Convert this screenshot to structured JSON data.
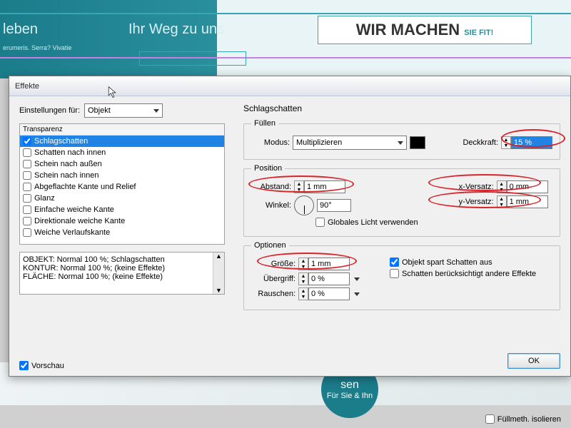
{
  "bg": {
    "nav1": "leben",
    "nav2": "Ihr Weg zu uns",
    "slogan1": "WIR MACHEN ",
    "slogan2": "SIE FIT!",
    "subtext": "erumeris. Serra? Vivatie",
    "circle1": "sen",
    "circle2": "Für Sie & Ihn"
  },
  "dialog": {
    "title": "Effekte",
    "settings_for": "Einstellungen für:",
    "settings_value": "Objekt",
    "listheader": "Transparenz",
    "effects": [
      {
        "label": "Schlagschatten",
        "checked": true,
        "sel": true
      },
      {
        "label": "Schatten nach innen",
        "checked": false
      },
      {
        "label": "Schein nach außen",
        "checked": false
      },
      {
        "label": "Schein nach innen",
        "checked": false
      },
      {
        "label": "Abgeflachte Kante und Relief",
        "checked": false
      },
      {
        "label": "Glanz",
        "checked": false
      },
      {
        "label": "Einfache weiche Kante",
        "checked": false
      },
      {
        "label": "Direktionale weiche Kante",
        "checked": false
      },
      {
        "label": "Weiche Verlaufskante",
        "checked": false
      }
    ],
    "summary": [
      "OBJEKT: Normal 100 %; Schlagschatten",
      "KONTUR: Normal 100 %; (keine Effekte)",
      "FLÄCHE: Normal 100 %; (keine Effekte)"
    ],
    "preview": "Vorschau",
    "right": {
      "title": "Schlagschatten",
      "fill": {
        "legend": "Füllen",
        "mode_label": "Modus:",
        "mode_value": "Multiplizieren",
        "opacity_label": "Deckkraft:",
        "opacity_value": "15 %"
      },
      "pos": {
        "legend": "Position",
        "distance_label": "Abstand:",
        "distance_value": "1 mm",
        "angle_label": "Winkel:",
        "angle_value": "90°",
        "global": "Globales Licht verwenden",
        "x_label": "x-Versatz:",
        "x_value": "0 mm",
        "y_label": "y-Versatz:",
        "y_value": "1 mm"
      },
      "opt": {
        "legend": "Optionen",
        "size_label": "Größe:",
        "size_value": "1 mm",
        "spread_label": "Übergriff:",
        "spread_value": "0 %",
        "noise_label": "Rauschen:",
        "noise_value": "0 %",
        "knockout": "Objekt spart Schatten aus",
        "honors": "Schatten berücksichtigt andere Effekte"
      }
    },
    "ok": "OK",
    "footer_chk": "Füllmeth. isolieren"
  }
}
